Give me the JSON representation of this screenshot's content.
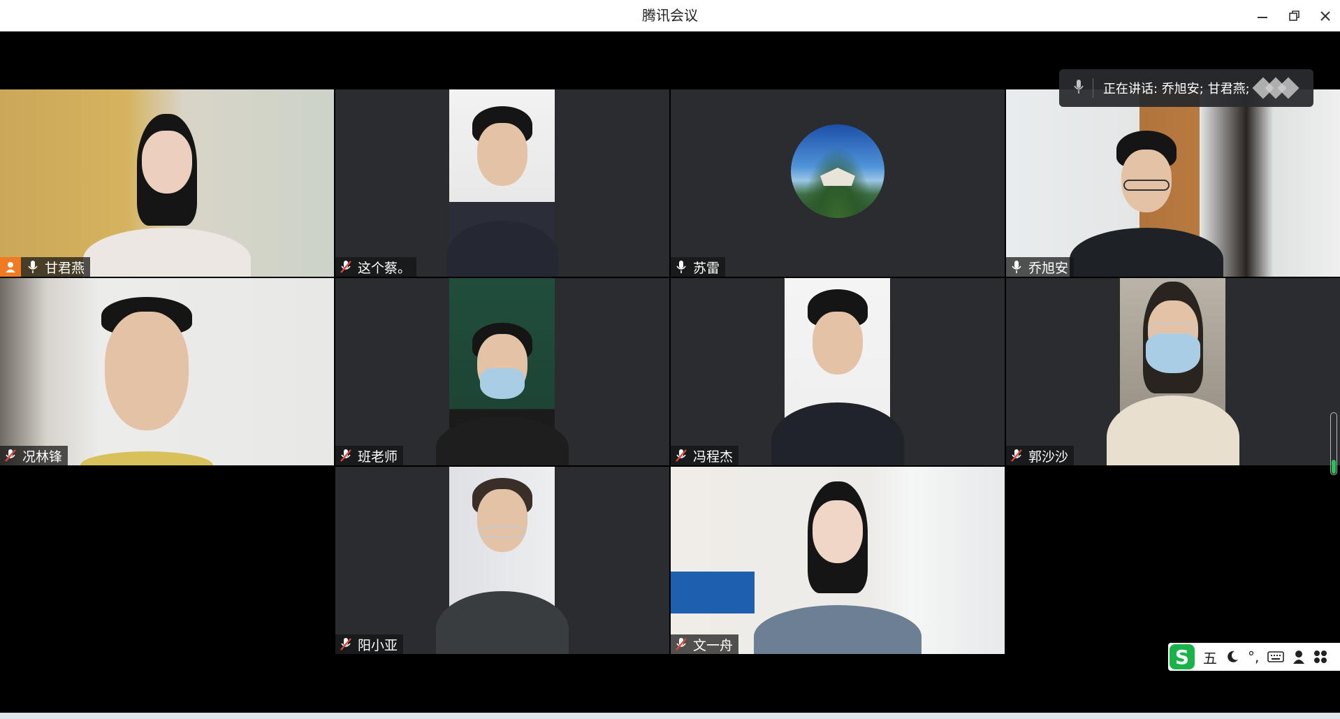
{
  "window": {
    "title": "腾讯会议",
    "controls": [
      "minimize-icon",
      "restore-icon",
      "close-icon"
    ]
  },
  "speaking_indicator": {
    "text": "正在讲话: 乔旭安; 甘君燕;"
  },
  "participants": [
    {
      "name": "甘君燕",
      "mic": "on",
      "host": true,
      "camera": "on"
    },
    {
      "name": "这个蔡。",
      "mic": "muted",
      "host": false,
      "camera": "on"
    },
    {
      "name": "苏雷",
      "mic": "on",
      "host": false,
      "camera": "off-avatar"
    },
    {
      "name": "乔旭安",
      "mic": "on",
      "host": false,
      "camera": "on",
      "speaking": true
    },
    {
      "name": "况林锋",
      "mic": "muted",
      "host": false,
      "camera": "on"
    },
    {
      "name": "班老师",
      "mic": "muted",
      "host": false,
      "camera": "on"
    },
    {
      "name": "冯程杰",
      "mic": "muted",
      "host": false,
      "camera": "on"
    },
    {
      "name": "郭沙沙",
      "mic": "muted",
      "host": false,
      "camera": "on"
    },
    {
      "name": "阳小亚",
      "mic": "muted",
      "host": false,
      "camera": "on"
    },
    {
      "name": "文一舟",
      "mic": "muted",
      "host": false,
      "camera": "on"
    }
  ],
  "ime_toolbar": {
    "logo": "S",
    "mode": "五",
    "icons": [
      "moon-icon",
      "punctuation-icon",
      "keyboard-icon",
      "user-icon",
      "grid-icon"
    ],
    "punctuation": "°,"
  },
  "colors": {
    "host_badge": "#f07b22",
    "speaking_outline": "#1fb86a",
    "muted_mic": "#e0443a",
    "ime_logo": "#19b34a"
  }
}
